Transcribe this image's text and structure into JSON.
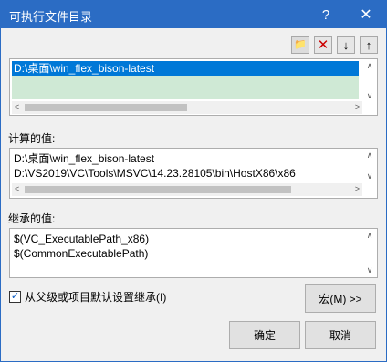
{
  "window": {
    "title": "可执行文件目录",
    "help_label": "?",
    "close_label": "✕"
  },
  "toolbar": {
    "new_line_icon": "new-folder-icon",
    "delete_icon": "delete-icon",
    "move_down_icon": "arrow-down-icon",
    "move_up_icon": "arrow-up-icon",
    "new_line_glyph": "📁",
    "delete_glyph": "✕",
    "move_down_glyph": "↓",
    "move_up_glyph": "↑"
  },
  "edit_list": {
    "items": [
      "D:\\桌面\\win_flex_bison-latest"
    ],
    "selected_index": 0
  },
  "computed": {
    "label": "计算的值:",
    "lines": [
      "D:\\桌面\\win_flex_bison-latest",
      "D:\\VS2019\\VC\\Tools\\MSVC\\14.23.28105\\bin\\HostX86\\x86"
    ]
  },
  "inherited": {
    "label": "继承的值:",
    "lines": [
      "$(VC_ExecutablePath_x86)",
      "$(CommonExecutablePath)"
    ]
  },
  "inherit_checkbox": {
    "label": "从父级或项目默认设置继承(I)",
    "checked": true,
    "check_glyph": "✓"
  },
  "buttons": {
    "macro": "宏(M) >>",
    "ok": "确定",
    "cancel": "取消"
  },
  "scroll": {
    "up": "∧",
    "down": "∨",
    "left": "<",
    "right": ">"
  },
  "colors": {
    "titlebar": "#2b6cc4",
    "selection": "#0078d7",
    "edit_row": "#cfe9d5"
  }
}
